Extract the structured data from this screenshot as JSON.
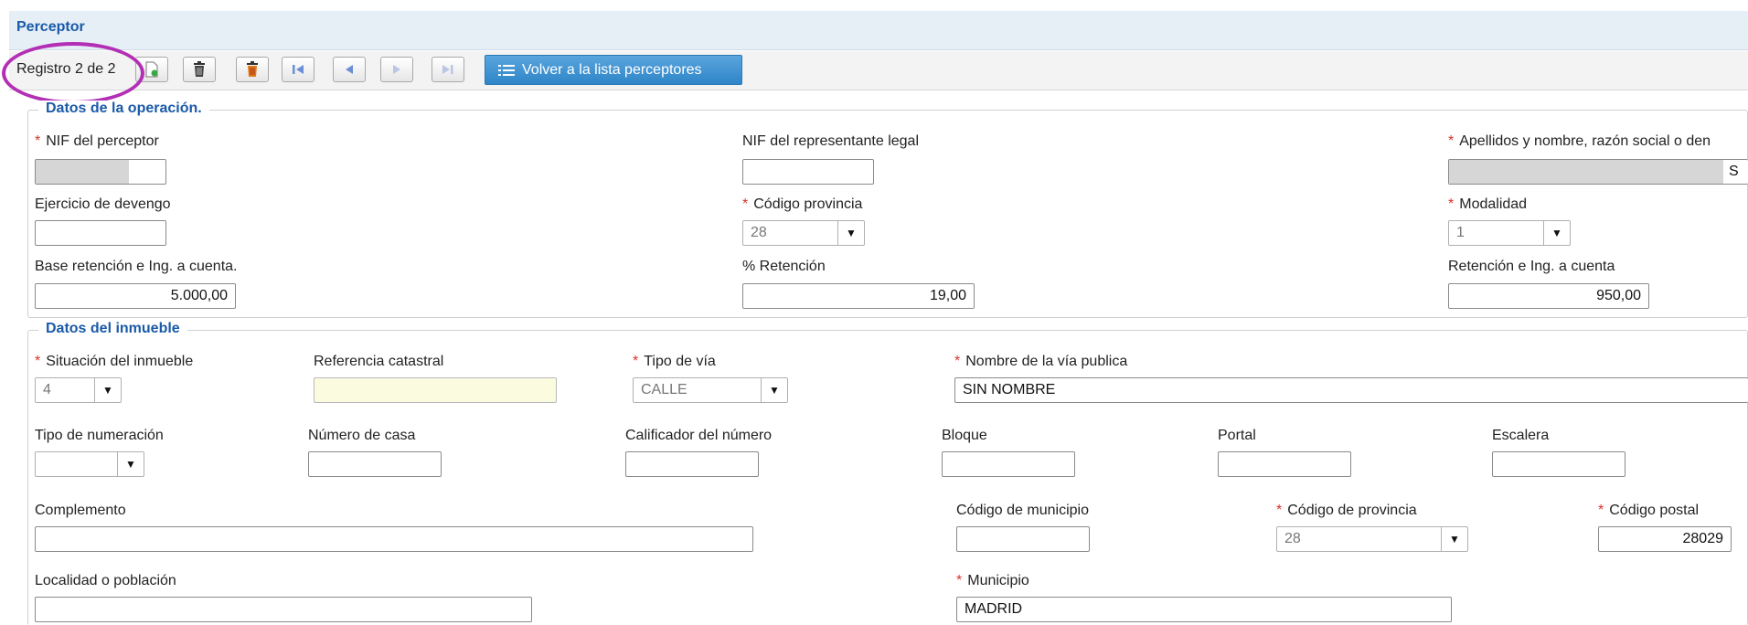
{
  "header": {
    "title": "Perceptor"
  },
  "toolbar": {
    "record_label": "Registro 2 de 2",
    "back_button": "Volver a la lista perceptores"
  },
  "operacion": {
    "legend": "Datos de la operación.",
    "nif_perceptor": {
      "label": "NIF del perceptor",
      "required": true
    },
    "nif_representante": {
      "label": "NIF del representante legal",
      "value": ""
    },
    "apellidos": {
      "label": "Apellidos y nombre, razón social o den",
      "required": true,
      "value_tail": "S"
    },
    "ejercicio": {
      "label": "Ejercicio de devengo",
      "value": ""
    },
    "codigo_provincia": {
      "label": "Código provincia",
      "required": true,
      "value": "28"
    },
    "modalidad": {
      "label": "Modalidad",
      "required": true,
      "value": "1"
    },
    "base_retencion": {
      "label": "Base retención e Ing. a cuenta.",
      "value": "5.000,00"
    },
    "pct_retencion": {
      "label": "% Retención",
      "value": "19,00"
    },
    "retencion": {
      "label": "Retención e Ing. a cuenta",
      "value": "950,00"
    }
  },
  "inmueble": {
    "legend": "Datos del inmueble",
    "situacion": {
      "label": "Situación del inmueble",
      "required": true,
      "value": "4"
    },
    "ref_catastral": {
      "label": "Referencia catastral",
      "value": ""
    },
    "tipo_via": {
      "label": "Tipo de vía",
      "required": true,
      "value": "CALLE"
    },
    "nombre_via": {
      "label": "Nombre de la vía publica",
      "required": true,
      "value": "SIN NOMBRE"
    },
    "tipo_numeracion": {
      "label": "Tipo de numeración",
      "value": ""
    },
    "numero_casa": {
      "label": "Número de casa",
      "value": ""
    },
    "calificador": {
      "label": "Calificador del número",
      "value": ""
    },
    "bloque": {
      "label": "Bloque",
      "value": ""
    },
    "portal": {
      "label": "Portal",
      "value": ""
    },
    "escalera": {
      "label": "Escalera",
      "value": ""
    },
    "complemento": {
      "label": "Complemento",
      "value": ""
    },
    "codigo_municipio": {
      "label": "Código de municipio",
      "value": ""
    },
    "codigo_provincia": {
      "label": "Código de provincia",
      "required": true,
      "value": "28"
    },
    "codigo_postal": {
      "label": "Código postal",
      "required": true,
      "value": "28029"
    },
    "localidad": {
      "label": "Localidad o población",
      "value": ""
    },
    "municipio": {
      "label": "Municipio",
      "required": true,
      "value": "MADRID"
    }
  },
  "colors": {
    "accent": "#1a5aa8",
    "required": "#d9342b",
    "highlight": "#b32fb5",
    "button": "#2e86c8"
  }
}
